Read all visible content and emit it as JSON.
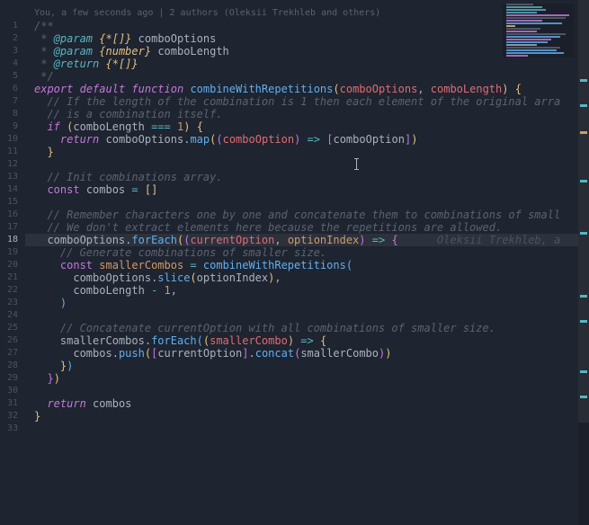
{
  "blame": "You, a few seconds ago | 2 authors (Oleksii Trekhleb and others)",
  "inline_author": "Oleksii Trekhleb, a",
  "doc": {
    "open": "/**",
    "p1_tag": "@param",
    "p1_type": "{*[]}",
    "p1_name": "comboOptions",
    "p2_tag": "@param",
    "p2_type": "{number}",
    "p2_name": "comboLength",
    "ret_tag": "@return",
    "ret_type": "{*[]}",
    "close": " */"
  },
  "l5": {
    "kw1": "export",
    "kw2": "default",
    "kw3": "function",
    "fn": "combineWithRepetitions",
    "a1": "comboOptions",
    "a2": "comboLength"
  },
  "l6": "// If the length of the combination is 1 then each element of the original arra",
  "l7": "// is a combination itself.",
  "l8": {
    "kw": "if",
    "var": "comboLength",
    "op": "===",
    "num": "1"
  },
  "l9": {
    "kw": "return",
    "v": "comboOptions",
    "fn": "map",
    "arg": "comboOption",
    "arr": "=>",
    "ret": "comboOption"
  },
  "l12": "// Init combinations array.",
  "l13": {
    "kw": "const",
    "v": "combos",
    "eq": "="
  },
  "l15": "// Remember characters one by one and concatenate them to combinations of small",
  "l16": "// We don't extract elements here because the repetitions are allowed.",
  "l17": {
    "v": "comboOptions",
    "fn": "forEach",
    "a1": "currentOption",
    "a2": "optionIndex",
    "arr": "=>"
  },
  "l18": "// Generate combinations of smaller size.",
  "l19": {
    "kw": "const",
    "v": "smallerCombos",
    "fn": "combineWithRepetitions"
  },
  "l20": {
    "v": "comboOptions",
    "fn": "slice",
    "a": "optionIndex"
  },
  "l21": {
    "v": "comboLength",
    "op": "-",
    "n": "1"
  },
  "l24": "// Concatenate currentOption with all combinations of smaller size.",
  "l25": {
    "v": "smallerCombos",
    "fn": "forEach",
    "a": "smallerCombo",
    "arr": "=>"
  },
  "l26": {
    "v": "combos",
    "fn": "push",
    "a1": "currentOption",
    "fn2": "concat",
    "a2": "smallerCombo"
  },
  "l30": {
    "kw": "return",
    "v": "combos"
  },
  "lines": [
    "1",
    "2",
    "3",
    "4",
    "5",
    "6",
    "7",
    "8",
    "9",
    "10",
    "11",
    "12",
    "13",
    "14",
    "15",
    "16",
    "17",
    "18",
    "19",
    "20",
    "21",
    "22",
    "23",
    "24",
    "25",
    "26",
    "27",
    "28",
    "29",
    "30",
    "31",
    "32",
    "33"
  ]
}
